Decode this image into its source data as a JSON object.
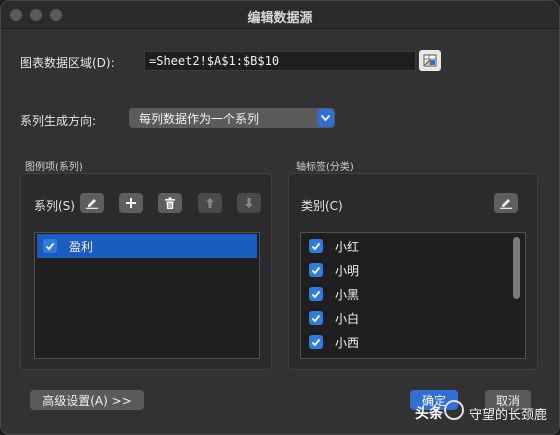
{
  "window": {
    "title": "编辑数据源"
  },
  "data_range": {
    "label": "图表数据区域(D):",
    "value": "=Sheet2!$A$1:$B$10"
  },
  "series_direction": {
    "label": "系列生成方向:",
    "selected": "每列数据作为一个系列"
  },
  "legend_group": {
    "title": "图例项(系列)",
    "series_label": "系列(S)",
    "items": [
      {
        "label": "盈利",
        "checked": true,
        "selected": true
      }
    ]
  },
  "axis_group": {
    "title": "轴标签(分类)",
    "category_label": "类别(C)",
    "items": [
      {
        "label": "小红",
        "checked": true
      },
      {
        "label": "小明",
        "checked": true
      },
      {
        "label": "小黑",
        "checked": true
      },
      {
        "label": "小白",
        "checked": true
      },
      {
        "label": "小西",
        "checked": true
      }
    ]
  },
  "footer": {
    "advanced_label": "高级设置(A) >>",
    "ok_label": "确定",
    "cancel_label": "取消"
  },
  "watermark": {
    "brand": "头条",
    "handle": "守望的长颈鹿"
  },
  "colors": {
    "accent": "#2f6fd6",
    "selection": "#1b5cc1",
    "window_bg": "#323232"
  }
}
